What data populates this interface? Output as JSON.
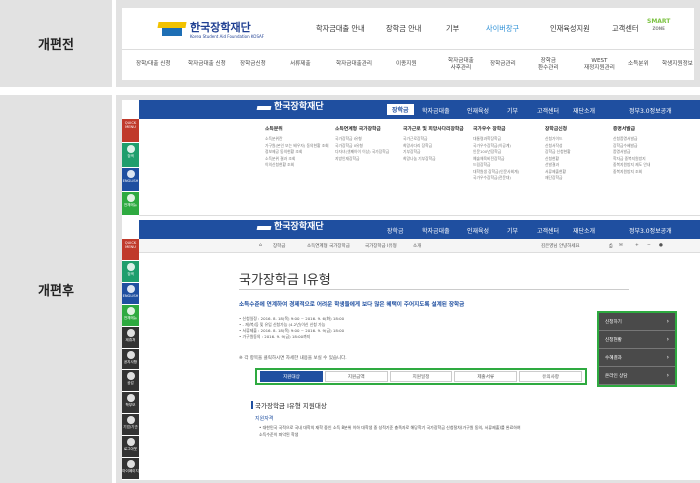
{
  "labels": {
    "before": "개편전",
    "after": "개편후"
  },
  "before": {
    "logo": {
      "kr": "한국장학재단",
      "en": "Korea Student Aid Foundation KOSAF"
    },
    "menu": [
      "학자금대출 안내",
      "장학금 안내",
      "기부",
      "사이버창구",
      "인재육성지원",
      "고객센터"
    ],
    "smart": {
      "a": "SMART",
      "b": "ZONE"
    },
    "submenu": [
      "장학/대출 신청",
      "학자금대출 신청",
      "장학금신청",
      "서류제출",
      "학자금대출관리",
      "이종지원",
      "학자금대출\n사후관리",
      "장학금관리",
      "장학금\n환수관리",
      "WEST\n재정지원관리",
      "소득분위",
      "학생지원정보"
    ]
  },
  "after": {
    "logo": {
      "kr": "한국장학재단",
      "en": "Korea Student Aid Foundation KOSAF"
    },
    "menu": [
      "장학금",
      "학자금대출",
      "인재육성",
      "기부",
      "고객센터",
      "재단소개"
    ],
    "right": "정부3.0정보공개",
    "sidebar": [
      "QUICK MENU",
      "검색",
      "ENGLISH",
      "전체메뉴"
    ],
    "sidebar2": [
      "QUICK MENU",
      "검색",
      "ENGLISH",
      "전체메뉴",
      "제휴처",
      "공지사항",
      "공감",
      "학부모",
      "기업/기관",
      "로그아웃",
      "마이페이지"
    ],
    "columns": [
      {
        "h": "소득분위",
        "items": [
          "소득분위란",
          "가구원(본인 또는 배우자) 동의현황 조회",
          "정보제공 동의현황 조회",
          "소득분위 결과 조회",
          "이의신청현황 조회"
        ]
      },
      {
        "h": "소득연계형 국가장학금",
        "items": [
          "국가장학금 I유형",
          "국가장학금 II유형",
          "다자녀(셋째아이 이상) 국가장학금",
          "지방인재장학금"
        ]
      },
      {
        "h": "국가근로 및 희망사다리장학금",
        "items": [
          "국가근로장학금",
          "희망사다리 장학금",
          "기부장학금",
          "희망나눔 기부장학금"
        ]
      },
      {
        "h": "국가우수 장학금",
        "items": [
          "대통령과학장학금",
          "국가우수장학금(이공계)",
          "인문100년장학금",
          "예술체육비전장학금",
          "드림장학금",
          "대학원생 장학금(인문사회계)",
          "국가우수장학금(전문대)"
        ]
      },
      {
        "h": "장학금신청",
        "items": [
          "신청가이드",
          "신청서작성",
          "장학금 신청현황",
          "신청현황",
          "선발결과",
          "서류제출현황",
          "재단장학금"
        ]
      },
      {
        "h": "증명서발급",
        "items": [
          "신청증명서발급",
          "장학금수혜발급",
          "증명서발급",
          "학자금 중복지원방지",
          "중복지원방지 제도 안내",
          "중복지원방지 조회"
        ]
      }
    ],
    "crumb": [
      "장학금",
      "소득연계형 국가장학금",
      "국가장학금 I유형",
      "소개"
    ],
    "user": "김은영님 안녕하세요",
    "title": "국가장학금 I유형",
    "desc": "소득수준에 연계하여 경제적으로 어려운 학생들에게 보다 많은 혜택이 주어지도록 설계된 장학금",
    "info": [
      "신청일정 : 2016. 8. 18(목) 9:00 ~ 2016. 9. 6(화) 18:00",
      "- 재/복/등 및 유입 신청가능 (4.2년)이신 신청 가능",
      "서류제출 : 2016. 8. 18(목) 9:00 ~ 2016. 9. 9(금) 18:00",
      "가구원동의 : 2016. 9. 9(금) 18:00까지"
    ],
    "note": "※ 각 항목을 클릭하시면 자세한 내용을 보실 수 있습니다.",
    "tabs": [
      "지원대상",
      "지원금액",
      "지원일정",
      "제출서류",
      "유의사항"
    ],
    "sidebtns": [
      "신청하기",
      "신청현황",
      "수혜결과",
      "온라인 상담"
    ],
    "section": "국가장학금 I유형 지원대상",
    "sub": "지원자격",
    "bullets": [
      "대한민국 국적으로 국내 대학의 재학 중인 소득 8분위 이하 대학생 중 성적기준 충족자로 해당학기 국가장학금 신청절차(가구원 동의, 서류제출)를 완료하여",
      "소득수준이 파악된 학생"
    ]
  }
}
